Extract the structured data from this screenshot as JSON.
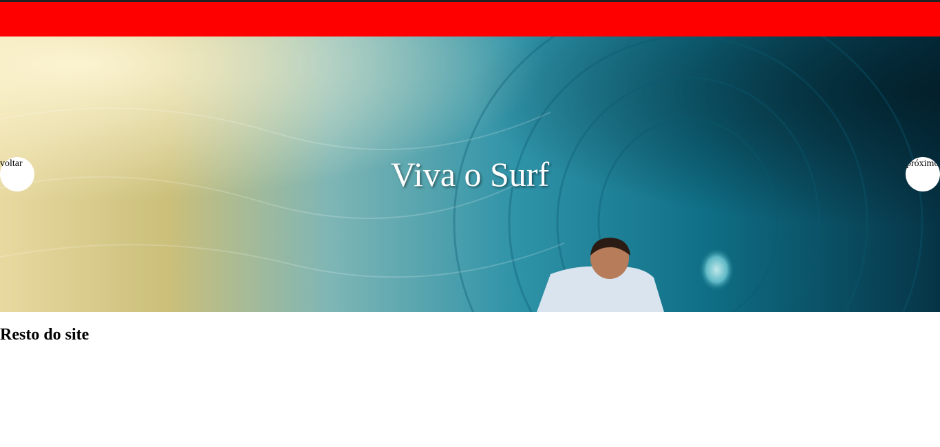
{
  "header": {
    "bar_color": "#ff0000"
  },
  "hero": {
    "title": "Viva o Surf",
    "prev_label": "voltar",
    "next_label": "próximo",
    "image": "surfer-in-wave-tube"
  },
  "main": {
    "section_title": "Resto do site"
  }
}
